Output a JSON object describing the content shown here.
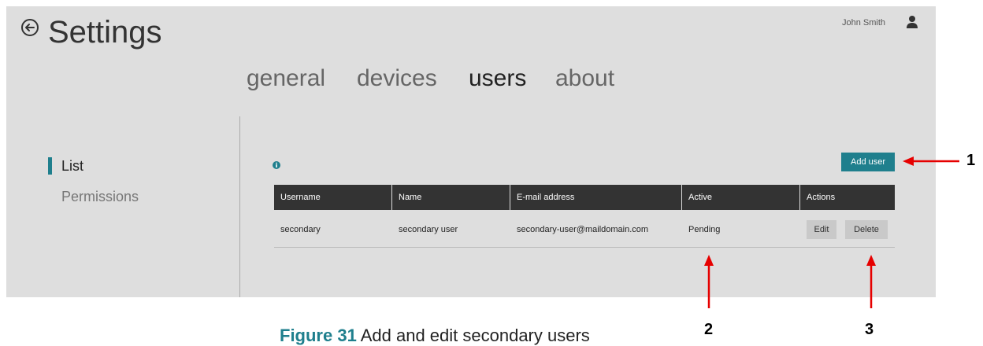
{
  "header": {
    "title": "Settings",
    "user_name": "John Smith"
  },
  "tabs": [
    {
      "label": "general",
      "active": false
    },
    {
      "label": "devices",
      "active": false
    },
    {
      "label": "users",
      "active": true
    },
    {
      "label": "about",
      "active": false
    }
  ],
  "sidebar": {
    "items": [
      {
        "label": "List",
        "active": true
      },
      {
        "label": "Permissions",
        "active": false
      }
    ]
  },
  "toolbar": {
    "add_user_label": "Add user"
  },
  "table": {
    "columns": [
      "Username",
      "Name",
      "E-mail address",
      "Active",
      "Actions"
    ],
    "rows": [
      {
        "username": "secondary",
        "name": "secondary user",
        "email": "secondary-user@maildomain.com",
        "active": "Pending",
        "edit_label": "Edit",
        "delete_label": "Delete"
      }
    ]
  },
  "annotations": {
    "callout_1": "1",
    "callout_2": "2",
    "callout_3": "3"
  },
  "caption": {
    "figure": "Figure 31",
    "text": "Add and edit secondary users"
  },
  "colors": {
    "accent": "#1f7f8d",
    "header_bg": "#333333",
    "app_bg": "#dedede",
    "annotation": "#e60000"
  }
}
